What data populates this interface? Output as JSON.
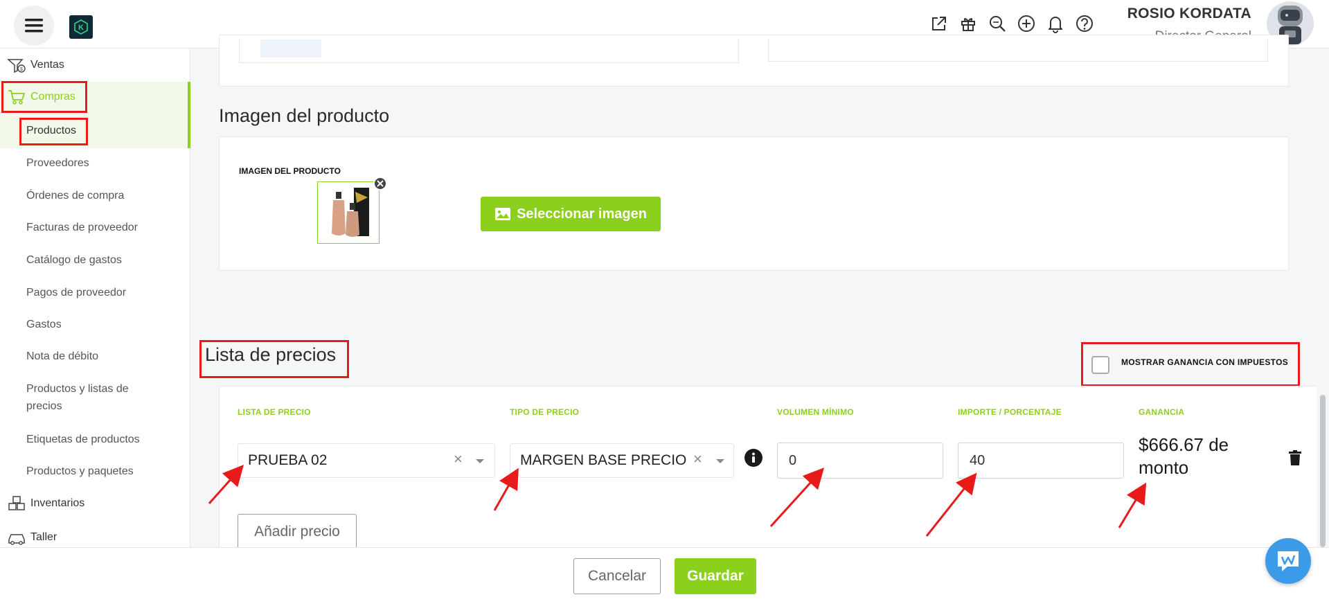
{
  "header": {
    "user_name": "ROSIO KORDATA",
    "user_role": "Director General",
    "icons": [
      "external-link-icon",
      "gift-icon",
      "search-zoom-icon",
      "plus-circle-icon",
      "bell-icon",
      "help-icon"
    ]
  },
  "sidebar": {
    "ventas": "Ventas",
    "compras": "Compras",
    "items": [
      "Productos",
      "Proveedores",
      "Órdenes de compra",
      "Facturas de proveedor",
      "Catálogo de gastos",
      "Pagos de proveedor",
      "Gastos",
      "Nota de débito",
      "Productos y listas de",
      "precios",
      "Etiquetas de productos",
      "Productos y paquetes"
    ],
    "inventarios": "Inventarios",
    "taller": "Taller"
  },
  "image_section": {
    "title": "Imagen del producto",
    "label": "IMAGEN DEL PRODUCTO",
    "select_button": "Seleccionar imagen"
  },
  "price_list": {
    "title": "Lista de precios",
    "show_profit_checkbox_label": "MOSTRAR GANANCIA CON IMPUESTOS",
    "show_profit_checked": false,
    "columns": {
      "list": "LISTA DE PRECIO",
      "type": "TIPO DE PRECIO",
      "min_volume": "VOLUMEN MÍNIMO",
      "amount": "IMPORTE / PORCENTAJE",
      "profit": "GANANCIA"
    },
    "row": {
      "list": "PRUEBA 02",
      "type": "MARGEN BASE PRECIO",
      "min_volume": "0",
      "amount": "40",
      "profit_line1": "$666.67 de",
      "profit_line2": "monto"
    },
    "add_button": "Añadir precio"
  },
  "footer": {
    "cancel": "Cancelar",
    "save": "Guardar"
  },
  "colors": {
    "accent": "#8bd01d",
    "highlight": "#e81a1a",
    "chat": "#3c9be8"
  }
}
